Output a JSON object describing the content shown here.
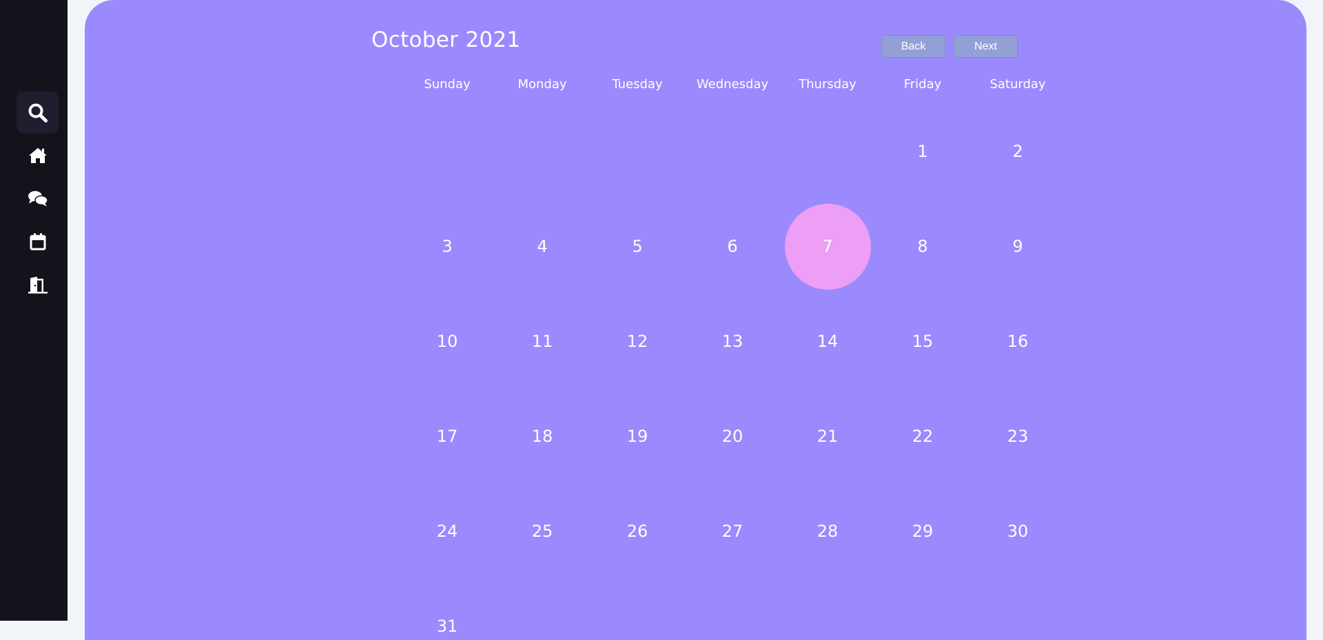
{
  "sidebar": {
    "items": [
      {
        "icon": "search-icon",
        "active": true
      },
      {
        "icon": "home-icon",
        "active": false
      },
      {
        "icon": "chat-icon",
        "active": false
      },
      {
        "icon": "calendar-icon",
        "active": false
      },
      {
        "icon": "logout-door-icon",
        "active": false
      }
    ]
  },
  "calendar": {
    "title": "October 2021",
    "back_label": "Back",
    "next_label": "Next",
    "weekdays": [
      "Sunday",
      "Monday",
      "Tuesday",
      "Wednesday",
      "Thursday",
      "Friday",
      "Saturday"
    ],
    "first_weekday_index": 5,
    "days_in_month": 31,
    "selected_day": 7
  },
  "colors": {
    "sidebar_bg": "#13131c",
    "panel_bg": "#9a8afd",
    "selected_day_bg": "#ec9ff5",
    "button_bg": "#93a0d8"
  }
}
